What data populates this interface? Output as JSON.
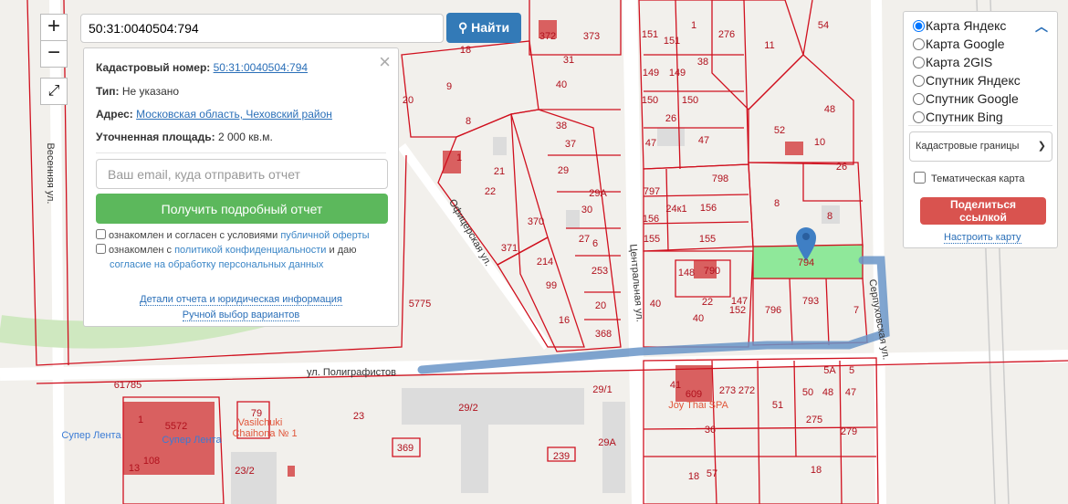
{
  "search": {
    "value": "50:31:0040504:794",
    "button": "Найти"
  },
  "zoom": {
    "in": "+",
    "out": "−"
  },
  "popup": {
    "cad_label": "Кадастровый номер:",
    "cad_value": "50:31:0040504:794",
    "type_label": "Тип:",
    "type_value": "Не указано",
    "addr_label": "Адрес:",
    "addr_value": "Московская область, Чеховский район",
    "area_label": "Уточненная площадь:",
    "area_value": "2 000 кв.м.",
    "email_placeholder": "Ваш email, куда отправить отчет",
    "report_button": "Получить подробный отчет",
    "cb1_text": "ознакомлен и согласен с условиями ",
    "cb1_link": "публичной оферты",
    "cb2_text": "ознакомлен с ",
    "cb2_link": "политикой конфиденциальности",
    "cb2_mid": " и даю",
    "cb2_link2": "согласие на обработку персональных данных",
    "details_link": "Детали отчета и юридическая информация",
    "manual_link": "Ручной выбор вариантов"
  },
  "layers": {
    "options": [
      "Карта Яндекс",
      "Карта Google",
      "Карта 2GIS",
      "Спутник Яндекс",
      "Спутник Google",
      "Спутник Bing"
    ],
    "selected": 0,
    "overlay_select": "Кадастровые границы",
    "thematic": "Тематическая карта",
    "share_button": "Поделиться ссылкой",
    "setup_link": "Настроить карту"
  },
  "colors": {
    "parcel": "#d0101e",
    "selected_parcel": "#90ee90",
    "route": "#6a95c8",
    "marker": "#3f7fc4"
  },
  "map": {
    "parcel_numbers": [
      "372",
      "373",
      "18",
      "9",
      "8",
      "40",
      "38",
      "37",
      "29",
      "21",
      "22",
      "1",
      "30",
      "370",
      "371",
      "214",
      "6",
      "253",
      "99",
      "20",
      "16",
      "368",
      "20",
      "5775",
      "151",
      "151",
      "1",
      "276",
      "38",
      "149",
      "149",
      "150",
      "150",
      "26",
      "47",
      "47",
      "52",
      "48",
      "10",
      "798",
      "797",
      "156",
      "24к1",
      "8",
      "26",
      "8",
      "155",
      "155",
      "794",
      "148",
      "790",
      "22",
      "40",
      "40",
      "796",
      "793",
      "7",
      "147",
      "41",
      "609",
      "273",
      "272",
      "51",
      "50",
      "48",
      "47",
      "5А",
      "5",
      "275",
      "279",
      "36",
      "57",
      "18",
      "18",
      "1",
      "5572",
      "108",
      "13",
      "79",
      "23",
      "29/2",
      "29/1",
      "29А",
      "369",
      "239",
      "23/2",
      "61785",
      "54",
      "11",
      "29А",
      "27",
      "31",
      "156",
      "152"
    ],
    "streets": [
      "ул. Полиграфистов",
      "Центральная ул.",
      "Серпуховская ул.",
      "Офицерская ул.",
      "Весенняя ул."
    ],
    "pois": [
      "Супер Лента",
      "Супер Лента",
      "Vasilchuki",
      "Chaihona № 1",
      "Joy Thai SPA"
    ]
  }
}
